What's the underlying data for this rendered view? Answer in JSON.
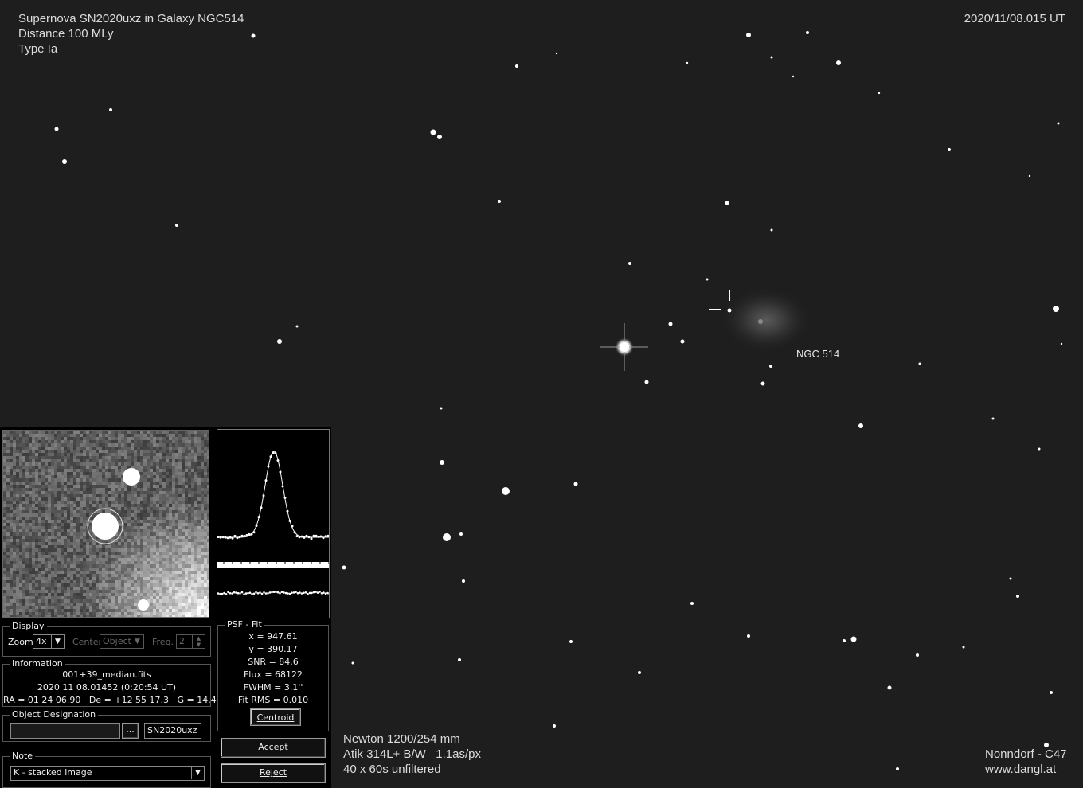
{
  "overlay": {
    "title_line1": "Supernova SN2020uxz in Galaxy NGC514",
    "title_line2": "Distance 100 MLy",
    "title_line3": "Type Ia",
    "timestamp": "2020/11/08.015 UT",
    "galaxy_label": "NGC 514",
    "equipment_line1": "Newton 1200/254 mm",
    "equipment_line2": "Atik 314L+ B/W   1.1as/px",
    "equipment_line3": "40 x 60s unfiltered",
    "observatory_line1": "Nonndorf - C47",
    "observatory_line2": "www.dangl.at"
  },
  "display": {
    "group_label": "Display",
    "zoom_label": "Zoom",
    "zoom_value": "4x",
    "center_label": "Center",
    "center_value": "Object",
    "freq_label": "Freq.",
    "freq_value": "2"
  },
  "information": {
    "group_label": "Information",
    "filename": "001+39_median.fits",
    "datetime": "2020 11 08.01452 (0:20:54 UT)",
    "coords": "RA = 01 24 06.90   De = +12 55 17.3   G = 14.4"
  },
  "designation": {
    "group_label": "Object Designation",
    "input_value": "",
    "browse_label": "...",
    "name_value": "SN2020uxz"
  },
  "note": {
    "group_label": "Note",
    "value": "K - stacked image"
  },
  "psf_fit": {
    "group_label": "PSF - Fit",
    "x": "x = 947.61",
    "y": "y = 390.17",
    "snr": "SNR = 84.6",
    "flux": "Flux = 68122",
    "fwhm": "FWHM = 3.1''",
    "fit_rms": "Fit RMS = 0.010",
    "centroid_label": "Centroid"
  },
  "actions": {
    "accept_label": "Accept",
    "reject_label": "Reject"
  },
  "colors": {
    "sky_background": "#1e1e1e",
    "panel_background": "#000000",
    "star": "#ffffff"
  }
}
